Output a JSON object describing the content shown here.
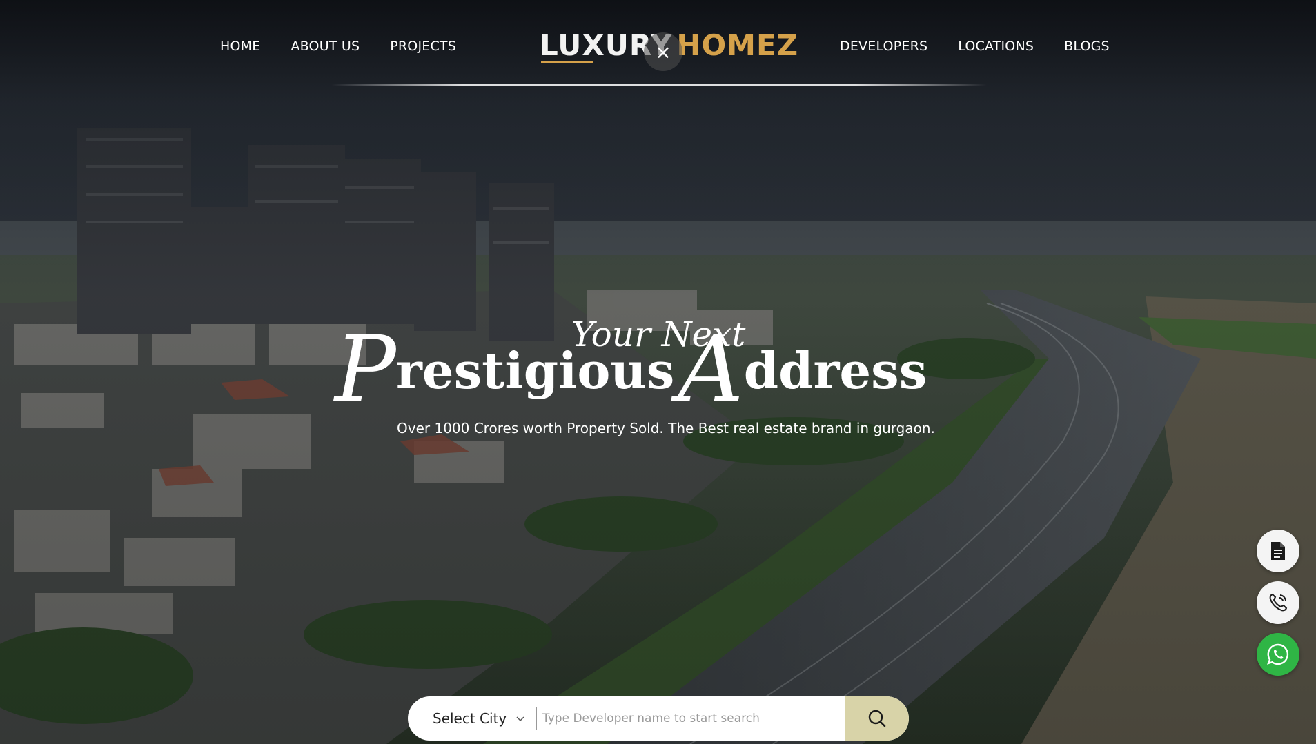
{
  "nav": {
    "left": [
      "HOME",
      "ABOUT US",
      "PROJECTS"
    ],
    "right": [
      "DEVELOPERS",
      "LOCATIONS",
      "BLOGS"
    ]
  },
  "logo": {
    "word1": "LUXURY",
    "word2": "HOMEZ"
  },
  "close_icon_glyph": "×",
  "hero": {
    "eyebrow": "Your Next",
    "headline": {
      "cap1": "P",
      "rest1": "restigious",
      "cap2": "A",
      "rest2": "ddress"
    },
    "subline": "Over 1000 Crores worth Property Sold. The Best real estate brand in gurgaon."
  },
  "search": {
    "city_label": "Select City",
    "placeholder": "Type Developer name to start search"
  },
  "floating": {
    "brochure_icon": "document-icon",
    "call_icon": "phone-icon",
    "whatsapp_icon": "whatsapp-icon"
  },
  "colors": {
    "accent_gold": "#d5a14a",
    "search_button": "#d8d3a8",
    "whatsapp_green": "#2fb545"
  }
}
